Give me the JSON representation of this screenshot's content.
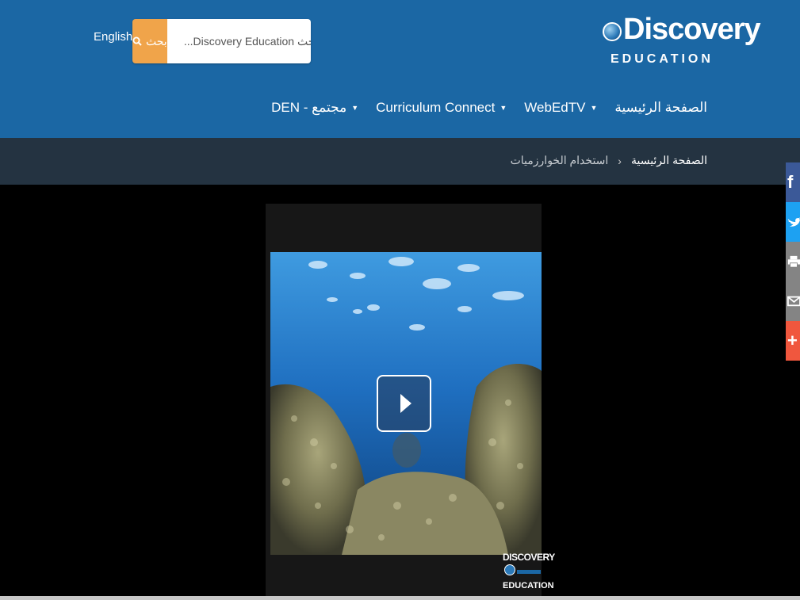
{
  "header": {
    "language_link": "English",
    "search": {
      "button_label": "بحث",
      "placeholder": "بحث Discovery Education..."
    },
    "logo": {
      "main": "Discovery",
      "sub": "EDUCATION"
    },
    "nav": [
      {
        "label": "الصفحة الرئيسية",
        "has_dropdown": false
      },
      {
        "label": "WebEdTV",
        "has_dropdown": true
      },
      {
        "label": "Curriculum Connect",
        "has_dropdown": true
      },
      {
        "label": "DEN - مجتمع",
        "has_dropdown": true
      }
    ]
  },
  "breadcrumb": {
    "home": "الصفحة الرئيسية",
    "separator": "›",
    "current": "استخدام الخوارزميات"
  },
  "video": {
    "watermark_top": "DISCOVERY",
    "watermark_bottom": "EDUCATION"
  },
  "social": [
    {
      "name": "facebook",
      "glyph": "f",
      "color": "#3b5998"
    },
    {
      "name": "twitter",
      "glyph": "t",
      "color": "#1da1f2"
    },
    {
      "name": "print",
      "glyph": "⎙",
      "color": "#848484"
    },
    {
      "name": "email",
      "glyph": "✉",
      "color": "#848484"
    },
    {
      "name": "more",
      "glyph": "+",
      "color": "#f0573e"
    }
  ],
  "colors": {
    "header_bg": "#1b67a4",
    "breadcrumb_bg": "#243341",
    "search_button": "#f0a44a"
  }
}
